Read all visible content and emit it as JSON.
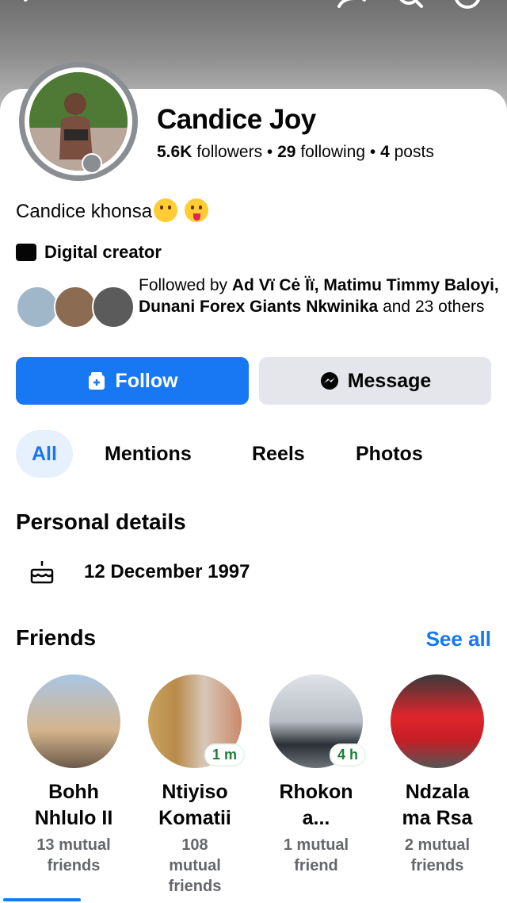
{
  "profile": {
    "name": "Candice Joy",
    "followers_count": "5.6K",
    "followers_label": "followers",
    "following_count": "29",
    "following_label": "following",
    "posts_count": "4",
    "posts_label": "posts",
    "separator": "•",
    "bio": "Candice khonsa",
    "category": "Digital creator"
  },
  "followed_by": {
    "prefix": "Followed by ",
    "names": "Ad Vï Cė Ïï, Matimu Timmy Baloyi, Dunani Forex Giants Nkwinika",
    "suffix": " and 23 others"
  },
  "actions": {
    "follow_label": "Follow",
    "message_label": "Message"
  },
  "tabs": [
    {
      "label": "All"
    },
    {
      "label": "Mentions"
    },
    {
      "label": "Reels"
    },
    {
      "label": "Photos"
    }
  ],
  "personal_details": {
    "title": "Personal details",
    "birthday": "12 December 1997"
  },
  "friends": {
    "title": "Friends",
    "see_all": "See all",
    "items": [
      {
        "name_line1": "Bohh",
        "name_line2": "Nhlulo II",
        "mutual_line1": "13 mutual",
        "mutual_line2": "friends",
        "mutual_line3": "",
        "badge": ""
      },
      {
        "name_line1": "Ntiyiso",
        "name_line2": "Komatii",
        "mutual_line1": "108",
        "mutual_line2": "mutual",
        "mutual_line3": "friends",
        "badge": "1 m"
      },
      {
        "name_line1": "Rhokon",
        "name_line2": "a...",
        "mutual_line1": "1 mutual",
        "mutual_line2": "friend",
        "mutual_line3": "",
        "badge": "4 h"
      },
      {
        "name_line1": "Ndzala",
        "name_line2": "ma Rsa",
        "mutual_line1": "2 mutual",
        "mutual_line2": "friends",
        "mutual_line3": "",
        "badge": ""
      }
    ]
  },
  "colors": {
    "accent": "#1877f2",
    "secondary_button": "#e4e6eb",
    "muted_text": "#65676b"
  },
  "icons": [
    "back-arrow-icon",
    "share-icon",
    "search-icon",
    "more-icon",
    "lock-icon",
    "clapperboard-icon",
    "follow-icon",
    "messenger-icon",
    "cake-icon"
  ]
}
